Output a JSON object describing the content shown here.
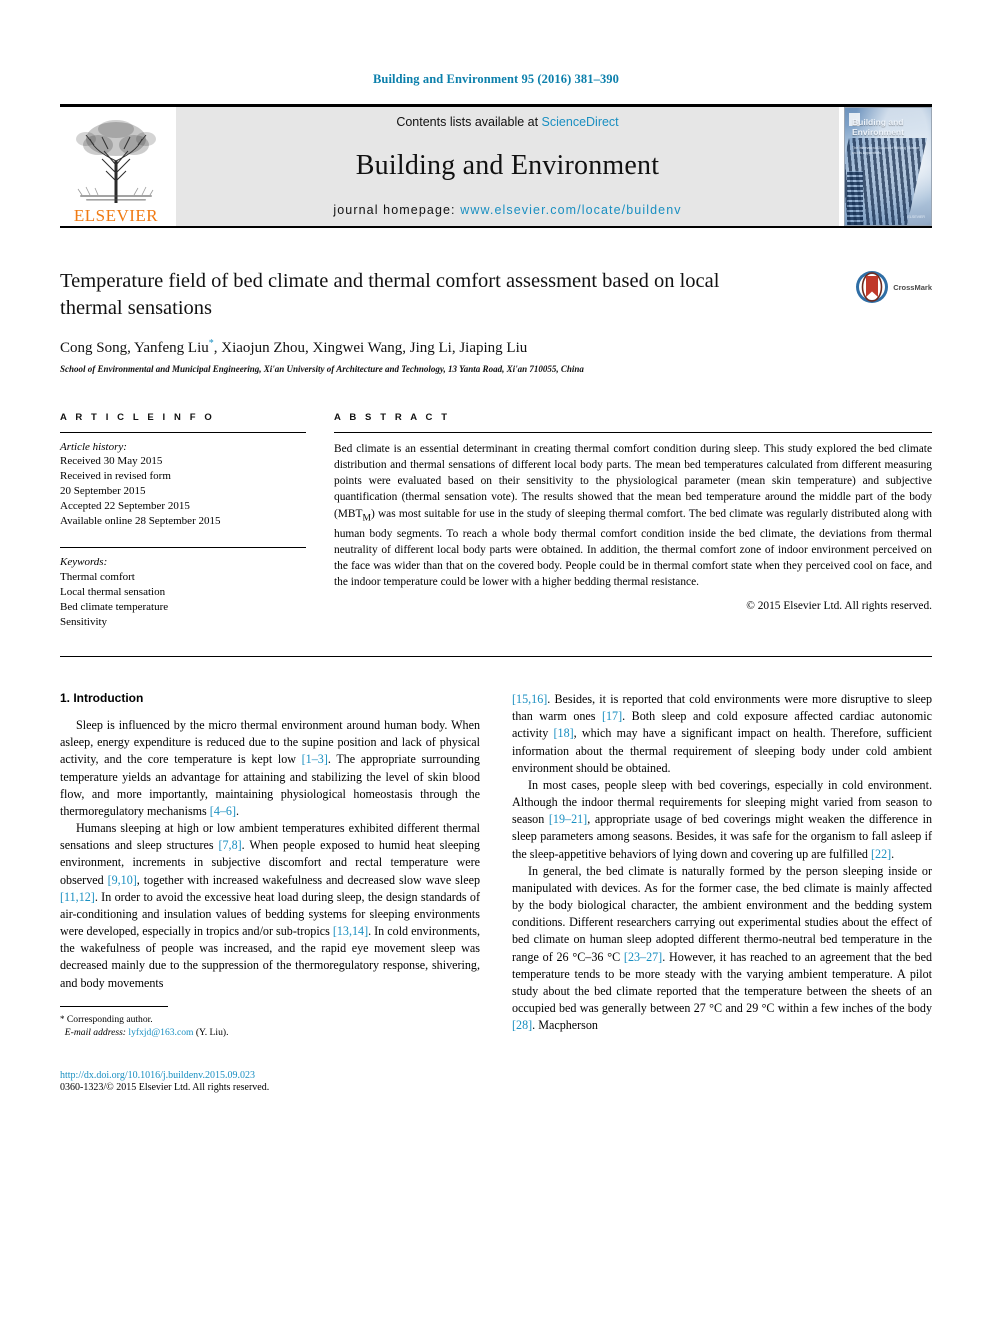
{
  "running_head": "Building and Environment 95 (2016) 381–390",
  "masthead": {
    "publisher_name": "ELSEVIER",
    "contents_prefix": "Contents lists available at ",
    "contents_link": "ScienceDirect",
    "journal_name": "Building and Environment",
    "homepage_prefix": "journal homepage: ",
    "homepage_url": "www.elsevier.com/locate/buildenv",
    "cover": {
      "title": "Building and Environment",
      "subtitle": "The International Journal of Building Science and its Applications",
      "imprint": "ELSEVIER"
    }
  },
  "article": {
    "title": "Temperature field of bed climate and thermal comfort assessment based on local thermal sensations",
    "authors": "Cong Song, Yanfeng Liu",
    "authors_marker": "*",
    "authors_rest": ", Xiaojun Zhou, Xingwei Wang, Jing Li, Jiaping Liu",
    "affiliation": "School of Environmental and Municipal Engineering, Xi'an University of Architecture and Technology, 13 Yanta Road, Xi'an 710055, China",
    "crossmark_label": "CrossMark"
  },
  "info": {
    "heading": "A R T I C L E  I N F O",
    "history_label": "Article history:",
    "history": [
      "Received 30 May 2015",
      "Received in revised form",
      "20 September 2015",
      "Accepted 22 September 2015",
      "Available online 28 September 2015"
    ],
    "keywords_label": "Keywords:",
    "keywords": [
      "Thermal comfort",
      "Local thermal sensation",
      "Bed climate temperature",
      "Sensitivity"
    ]
  },
  "abstract": {
    "heading": "A B S T R A C T",
    "text": "Bed climate is an essential determinant in creating thermal comfort condition during sleep. This study explored the bed climate distribution and thermal sensations of different local body parts. The mean bed temperatures calculated from different measuring points were evaluated based on their sensitivity to the physiological parameter (mean skin temperature) and subjective quantification (thermal sensation vote). The results showed that the mean bed temperature around the middle part of the body (MBT",
    "text_sub": "M",
    "text_after": ") was most suitable for use in the study of sleeping thermal comfort. The bed climate was regularly distributed along with human body segments. To reach a whole body thermal comfort condition inside the bed climate, the deviations from thermal neutrality of different local body parts were obtained. In addition, the thermal comfort zone of indoor environment perceived on the face was wider than that on the covered body. People could be in thermal comfort state when they perceived cool on face, and the indoor temperature could be lower with a higher bedding thermal resistance.",
    "copyright": "© 2015 Elsevier Ltd. All rights reserved."
  },
  "body": {
    "section_number_title": "1. Introduction",
    "left_p1_a": "Sleep is influenced by the micro thermal environment around human body. When asleep, energy expenditure is reduced due to the supine position and lack of physical activity, and the core temperature is kept low ",
    "left_p1_ref1": "[1–3]",
    "left_p1_b": ". The appropriate surrounding temperature yields an advantage for attaining and stabilizing the level of skin blood flow, and more importantly, maintaining physiological homeostasis through the thermoregulatory mechanisms ",
    "left_p1_ref2": "[4–6]",
    "left_p1_c": ".",
    "left_p2_a": "Humans sleeping at high or low ambient temperatures exhibited different thermal sensations and sleep structures ",
    "left_p2_ref1": "[7,8]",
    "left_p2_b": ". When people exposed to humid heat sleeping environment, increments in subjective discomfort and rectal temperature were observed ",
    "left_p2_ref2": "[9,10]",
    "left_p2_c": ", together with increased wakefulness and decreased slow wave sleep ",
    "left_p2_ref3": "[11,12]",
    "left_p2_d": ". In order to avoid the excessive heat load during sleep, the design standards of air-conditioning and insulation values of bedding systems for sleeping environments were developed, especially in tropics and/or sub-tropics ",
    "left_p2_ref4": "[13,14]",
    "left_p2_e": ". In cold environments, the wakefulness of people was increased, and the rapid eye movement sleep was decreased mainly due to the suppression of the thermoregulatory response, shivering, and body movements",
    "right_p1_ref1": "[15,16]",
    "right_p1_a": ". Besides, it is reported that cold environments were more disruptive to sleep than warm ones ",
    "right_p1_ref2": "[17]",
    "right_p1_b": ". Both sleep and cold exposure affected cardiac autonomic activity ",
    "right_p1_ref3": "[18]",
    "right_p1_c": ", which may have a significant impact on health. Therefore, sufficient information about the thermal requirement of sleeping body under cold ambient environment should be obtained.",
    "right_p2_a": "In most cases, people sleep with bed coverings, especially in cold environment. Although the indoor thermal requirements for sleeping might varied from season to season ",
    "right_p2_ref1": "[19–21]",
    "right_p2_b": ", appropriate usage of bed coverings might weaken the difference in sleep parameters among seasons. Besides, it was safe for the organism to fall asleep if the sleep-appetitive behaviors of lying down and covering up are fulfilled ",
    "right_p2_ref2": "[22]",
    "right_p2_c": ".",
    "right_p3_a": "In general, the bed climate is naturally formed by the person sleeping inside or manipulated with devices. As for the former case, the bed climate is mainly affected by the body biological character, the ambient environment and the bedding system conditions. Different researchers carrying out experimental studies about the effect of bed climate on human sleep adopted different thermo-neutral bed temperature in the range of 26 °C–36 °C ",
    "right_p3_ref1": "[23–27]",
    "right_p3_b": ". However, it has reached to an agreement that the bed temperature tends to be more steady with the varying ambient temperature. A pilot study about the bed climate reported that the temperature between the sheets of an occupied bed was generally between 27 °C and 29 °C within a few inches of the body ",
    "right_p3_ref2": "[28]",
    "right_p3_c": ". Macpherson"
  },
  "footer": {
    "corresponding_marker": "*",
    "corresponding_label": " Corresponding author.",
    "email_label": "E-mail address:",
    "email": "lyfxjd@163.com",
    "email_owner": " (Y. Liu).",
    "doi": "http://dx.doi.org/10.1016/j.buildenv.2015.09.023",
    "issn": "0360-1323/© 2015 Elsevier Ltd. All rights reserved."
  },
  "colors": {
    "link": "#1a8fc1",
    "running_head": "#0b7fab",
    "elsevier_orange": "#f07a12"
  }
}
